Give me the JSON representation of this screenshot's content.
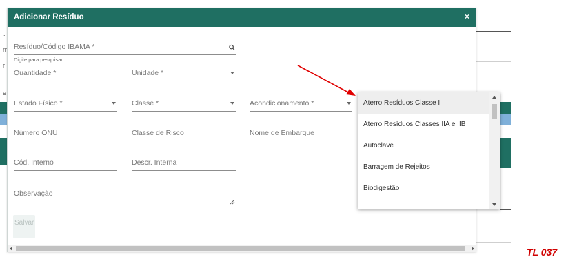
{
  "modal": {
    "title": "Adicionar Resíduo",
    "close_icon": "×"
  },
  "fields": {
    "residuo": {
      "label": "Resíduo/Código IBAMA *",
      "hint": "Digite para pesquisar"
    },
    "quantidade": {
      "label": "Quantidade *"
    },
    "unidade": {
      "label": "Unidade *"
    },
    "estado_fisico": {
      "label": "Estado Físico *"
    },
    "classe": {
      "label": "Classe *"
    },
    "acondicionamento": {
      "label": "Acondicionamento *"
    },
    "numero_onu": {
      "label": "Número ONU"
    },
    "classe_risco": {
      "label": "Classe de Risco"
    },
    "nome_embarque": {
      "label": "Nome de Embarque"
    },
    "cod_interno": {
      "label": "Cód. Interno"
    },
    "descr_interna": {
      "label": "Descr. Interna"
    },
    "observacao": {
      "label": "Observação"
    }
  },
  "buttons": {
    "save_label": "Salvar"
  },
  "dropdown": {
    "items": [
      {
        "label": "Aterro Resíduos Classe I",
        "highlighted": true
      },
      {
        "label": "Aterro Resíduos Classes IIA e IIB",
        "highlighted": false
      },
      {
        "label": "Autoclave",
        "highlighted": false
      },
      {
        "label": "Barragem de Rejeitos",
        "highlighted": false
      },
      {
        "label": "Biodigestão",
        "highlighted": false
      }
    ]
  },
  "annotation": {
    "label": "TL 037",
    "color": "#d00000"
  },
  "colors": {
    "header": "#1f6f62",
    "arrow": "#e00000"
  },
  "icons": {
    "search": "search-icon",
    "dropdown_caret": "chevron-down-icon",
    "resize": "resize-handle-icon",
    "close": "close-icon"
  }
}
